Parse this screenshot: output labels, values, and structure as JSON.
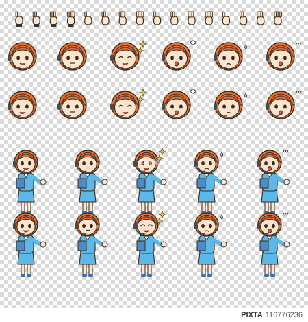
{
  "image_number": "116776236",
  "stock_brand": "PIXTA",
  "watermark_text": "PIXTA",
  "colors": {
    "hair": "#f26d2c",
    "skin": "#fde5cf",
    "outfit": "#5bb8e8",
    "outline": "#3a2a1a",
    "headset": "#4a4a4a",
    "sparkle": "#e8c443"
  },
  "hand_gestures": [
    "fist-up",
    "pointing",
    "ok",
    "open-palm",
    "wave",
    "thumbs",
    "pinch",
    "point-right",
    "one",
    "thumbs-up",
    "peace",
    "three",
    "four",
    "open-hand",
    "five",
    "palm"
  ],
  "face_rows": [
    [
      "smile",
      "neutral",
      "laugh-sparkle",
      "angry",
      "worried",
      "surprised"
    ],
    [
      "smile",
      "neutral",
      "laugh-sparkle",
      "angry",
      "worried",
      "surprised"
    ]
  ],
  "body_rows": [
    [
      "smile-point",
      "neutral-point",
      "smile-sparkle",
      "worried-sweat",
      "surprised"
    ],
    [
      "smile-point",
      "neutral-point",
      "laugh-sparkle",
      "worried-sweat",
      "surprised"
    ]
  ]
}
